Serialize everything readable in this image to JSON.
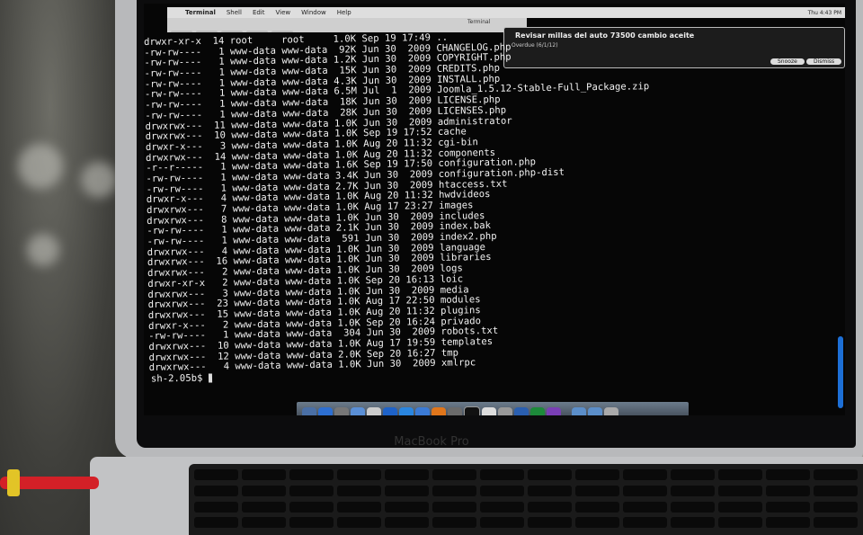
{
  "menubar": {
    "app": "Terminal",
    "items": [
      "Shell",
      "Edit",
      "View",
      "Window",
      "Help"
    ],
    "right": "Thu 4:43 PM"
  },
  "window_title": "Terminal",
  "notification": {
    "title": "Revisar millas del auto 73500 cambio aceite",
    "subtitle": "Overdue (6/1/12)",
    "snooze": "Snooze",
    "dismiss": "Dismiss"
  },
  "listing": [
    "drwxr-xr-x  14 root     root     1.0K Sep 19 17:49 ..",
    "-rw-rw----   1 www-data www-data  92K Jun 30  2009 CHANGELOG.php",
    "-rw-rw----   1 www-data www-data 1.2K Jun 30  2009 COPYRIGHT.php",
    "-rw-rw----   1 www-data www-data  15K Jun 30  2009 CREDITS.php",
    "-rw-rw----   1 www-data www-data 4.3K Jun 30  2009 INSTALL.php",
    "-rw-rw----   1 www-data www-data 6.5M Jul  1  2009 Joomla_1.5.12-Stable-Full_Package.zip",
    "-rw-rw----   1 www-data www-data  18K Jun 30  2009 LICENSE.php",
    "-rw-rw----   1 www-data www-data  28K Jun 30  2009 LICENSES.php",
    "drwxrwx---  11 www-data www-data 1.0K Jun 30  2009 administrator",
    "drwxrwx---  10 www-data www-data 1.0K Sep 19 17:52 cache",
    "drwxr-x---   3 www-data www-data 1.0K Aug 20 11:32 cgi-bin",
    "drwxrwx---  14 www-data www-data 1.0K Aug 20 11:32 components",
    "-r--r-----   1 www-data www-data 1.6K Sep 19 17:50 configuration.php",
    "-rw-rw----   1 www-data www-data 3.4K Jun 30  2009 configuration.php-dist",
    "-rw-rw----   1 www-data www-data 2.7K Jun 30  2009 htaccess.txt",
    "drwxr-x---   4 www-data www-data 1.0K Aug 20 11:32 hwdvideos",
    "drwxrwx---   7 www-data www-data 1.0K Aug 17 23:27 images",
    "drwxrwx---   8 www-data www-data 1.0K Jun 30  2009 includes",
    "-rw-rw----   1 www-data www-data 2.1K Jun 30  2009 index.bak",
    "-rw-rw----   1 www-data www-data  591 Jun 30  2009 index2.php",
    "drwxrwx---   4 www-data www-data 1.0K Jun 30  2009 language",
    "drwxrwx---  16 www-data www-data 1.0K Jun 30  2009 libraries",
    "drwxrwx---   2 www-data www-data 1.0K Jun 30  2009 logs",
    "drwxr-xr-x   2 www-data www-data 1.0K Sep 20 16:13 loic",
    "drwxrwx---   3 www-data www-data 1.0K Jun 30  2009 media",
    "drwxrwx---  23 www-data www-data 1.0K Aug 17 22:50 modules",
    "drwxrwx---  15 www-data www-data 1.0K Aug 20 11:32 plugins",
    "drwxr-x---   2 www-data www-data 1.0K Sep 20 16:24 privado",
    "-rw-rw----   1 www-data www-data  304 Jun 30  2009 robots.txt",
    "drwxrwx---  10 www-data www-data 1.0K Aug 17 19:59 templates",
    "drwxrwx---  12 www-data www-data 2.0K Sep 20 16:27 tmp",
    "drwxrwx---   4 www-data www-data 1.0K Jun 30  2009 xmlrpc"
  ],
  "prompt": "sh-2.05b$",
  "brand": "MacBook Pro"
}
